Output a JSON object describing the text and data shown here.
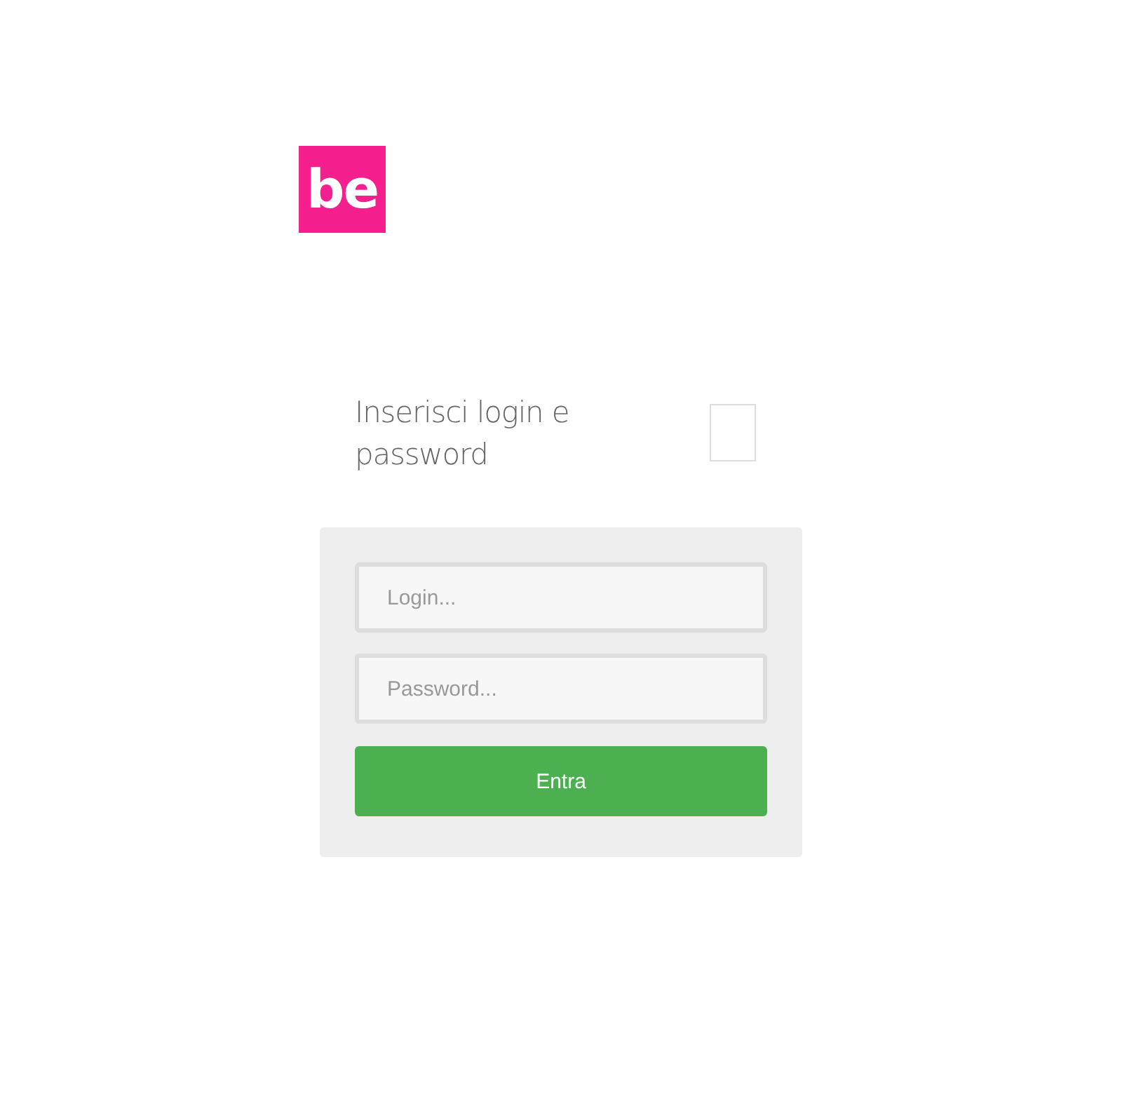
{
  "logo": {
    "text": "be"
  },
  "heading": "Inserisci login e password",
  "form": {
    "fields": [
      {
        "placeholder": "Login..."
      },
      {
        "placeholder": "Password..."
      }
    ],
    "submit": "Entra"
  }
}
